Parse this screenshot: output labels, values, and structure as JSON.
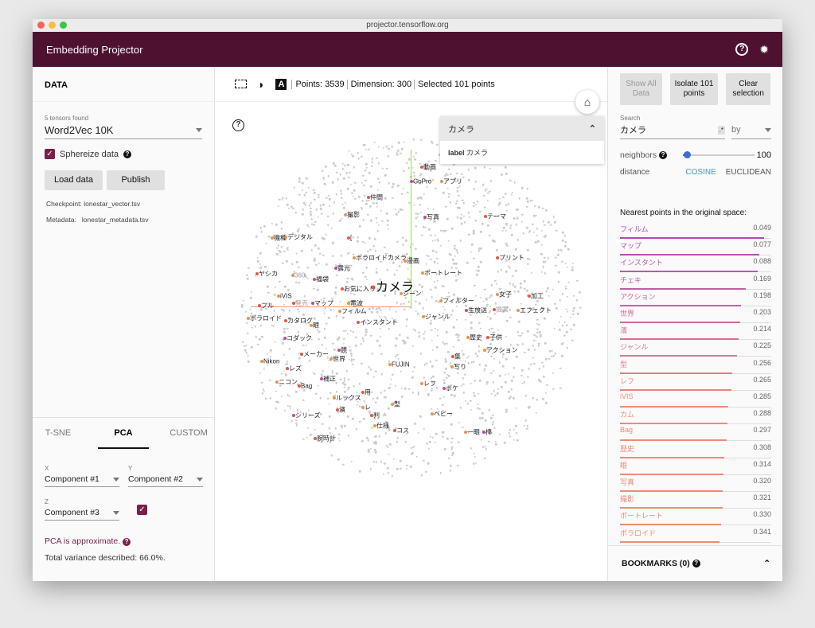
{
  "window": {
    "url": "projector.tensorflow.org"
  },
  "header": {
    "title": "Embedding Projector",
    "help_icon": "help-circle-icon",
    "bug_icon": "bug-icon"
  },
  "data_panel": {
    "title": "DATA",
    "tensors_found": "5 tensors found",
    "tensor": "Word2Vec 10K",
    "sphereize_label": "Sphereize data",
    "sphereize_checked": true,
    "load_label": "Load data",
    "publish_label": "Publish",
    "checkpoint_key": "Checkpoint:",
    "checkpoint_val": "lonestar_vector.tsv",
    "metadata_key": "Metadata:",
    "metadata_val": "lonestar_metadata.tsv"
  },
  "projection": {
    "tabs": [
      "T-SNE",
      "PCA",
      "CUSTOM"
    ],
    "active_tab": "PCA",
    "x_label": "X",
    "x_value": "Component #1",
    "y_label": "Y",
    "y_value": "Component #2",
    "z_label": "Z",
    "z_value": "Component #3",
    "z_checked": true,
    "approx": "PCA is approximate.",
    "variance": "Total variance described: 66.0%."
  },
  "toolbar": {
    "points": "Points: 3539",
    "dimension": "Dimension: 300",
    "selected": "Selected 101 points"
  },
  "inspector_card": {
    "title": "カメラ",
    "label_key": "label",
    "label_val": "カメラ"
  },
  "scatter": {
    "focus_label": "カメラ",
    "labels": [
      "動画",
      "GoPro",
      "アプリ",
      "仲間",
      "撮影",
      "写真",
      "テーマ",
      "機種",
      "デジタル",
      "[",
      "ポラロイドカメラ",
      "漫画",
      "プリント",
      "露光",
      "ポートレート",
      "ヤシカ",
      "360",
      "福袋",
      "お気に入り",
      "シーン",
      "女子",
      "加工",
      "iVIS",
      "フィルター",
      "発売",
      "マップ",
      "電波",
      "フル",
      "フィルム",
      "生放送",
      "提案",
      "エフェクト",
      "ポラロイド",
      "カタログ",
      "眼",
      "ジャンル",
      "インスタント",
      "コダック",
      "歴史",
      "子供",
      "アクション",
      "鏡",
      "メーカー",
      "世界",
      "Nikon",
      "集",
      "FUJIN",
      "写り",
      "レズ",
      "補正",
      "ニコン",
      "Bag",
      "レフ",
      "ポケ",
      "用",
      "ルックス",
      "型",
      "濱",
      "レ",
      "ベビー",
      "判",
      "シリーズ",
      "仕様",
      "コス",
      "一眼",
      "棒",
      "腕時計"
    ]
  },
  "inspector": {
    "show_all": "Show All Data",
    "isolate": "Isolate 101 points",
    "clear": "Clear selection",
    "search_label": "Search",
    "search_value": "カメラ",
    "regex": ".*",
    "by": "by",
    "neighbors_label": "neighbors",
    "neighbors_value": "100",
    "neighbors_fraction": 0.06,
    "distance_label": "distance",
    "cosine": "COSINE",
    "euclidean": "EUCLIDEAN",
    "active_distance": "COSINE",
    "nearest_title": "Nearest points in the original space:",
    "nearest": [
      {
        "w": "フィルム",
        "d": "0.049"
      },
      {
        "w": "マップ",
        "d": "0.077"
      },
      {
        "w": "インスタント",
        "d": "0.088"
      },
      {
        "w": "チェキ",
        "d": "0.169"
      },
      {
        "w": "アクション",
        "d": "0.198"
      },
      {
        "w": "世界",
        "d": "0.203"
      },
      {
        "w": "濱",
        "d": "0.214"
      },
      {
        "w": "ジャンル",
        "d": "0.225"
      },
      {
        "w": "型",
        "d": "0.256"
      },
      {
        "w": "レフ",
        "d": "0.265"
      },
      {
        "w": "iVIS",
        "d": "0.285"
      },
      {
        "w": "カム",
        "d": "0.288"
      },
      {
        "w": "Bag",
        "d": "0.297"
      },
      {
        "w": "歴史",
        "d": "0.308"
      },
      {
        "w": "眼",
        "d": "0.314"
      },
      {
        "w": "写真",
        "d": "0.320"
      },
      {
        "w": "撮影",
        "d": "0.321"
      },
      {
        "w": "ポートレート",
        "d": "0.330"
      },
      {
        "w": "ポラロイド",
        "d": "0.341"
      }
    ],
    "bookmarks": "BOOKMARKS (0)"
  },
  "colors": {
    "brand": "#4e1230",
    "accent": "#7b1e4a",
    "near": "#b04bb5",
    "far": "#f08a7a",
    "cosine": "#4a90e2",
    "axis_y": "#8fe04a",
    "axis_x": "#e8a070"
  }
}
